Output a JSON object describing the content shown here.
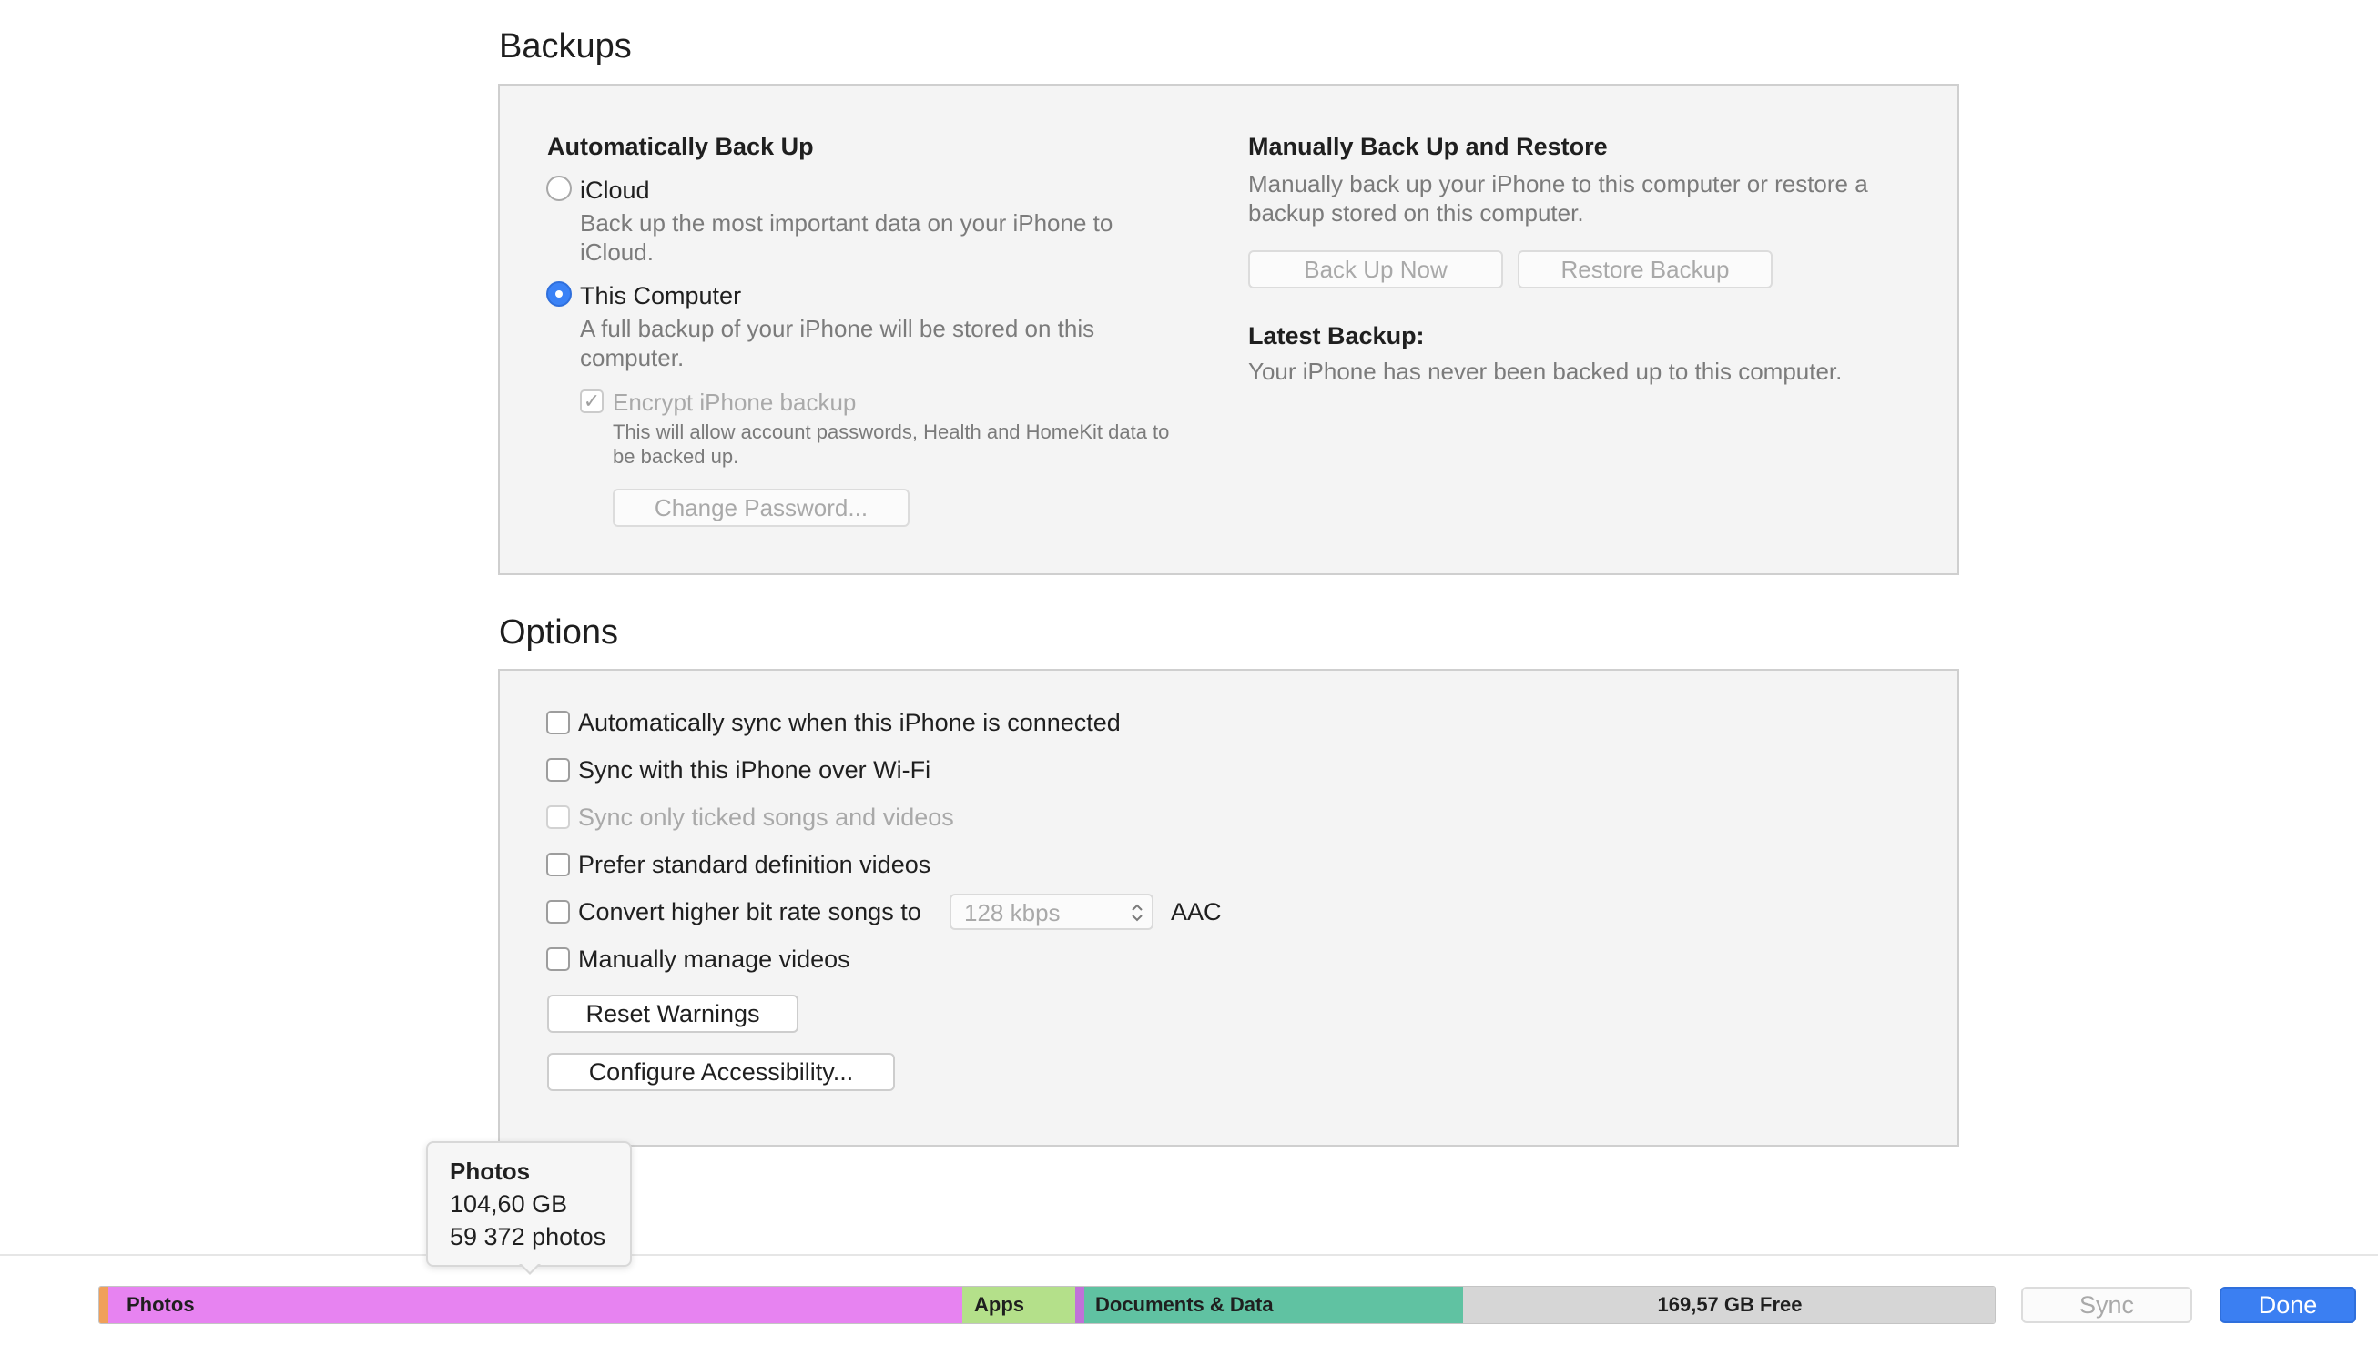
{
  "backups": {
    "title": "Backups",
    "auto": {
      "heading": "Automatically Back Up",
      "icloud_label": "iCloud",
      "icloud_desc_1": "Back up the most important data on your iPhone to",
      "icloud_desc_2": "iCloud.",
      "computer_label": "This Computer",
      "computer_desc_1": "A full backup of your iPhone will be stored on this",
      "computer_desc_2": "computer.",
      "encrypt_label": "Encrypt iPhone backup",
      "encrypt_desc_1": "This will allow account passwords, Health and HomeKit data to",
      "encrypt_desc_2": "be backed up.",
      "change_password": "Change Password...",
      "selected": "This Computer"
    },
    "manual": {
      "heading": "Manually Back Up and Restore",
      "desc_1": "Manually back up your iPhone to this computer or restore a",
      "desc_2": "backup stored on this computer.",
      "back_up_now": "Back Up Now",
      "restore_backup": "Restore Backup",
      "latest_heading": "Latest Backup:",
      "latest_text": "Your iPhone has never been backed up to this computer."
    }
  },
  "options": {
    "title": "Options",
    "items": [
      {
        "label": "Automatically sync when this iPhone is connected",
        "checked": false,
        "enabled": true
      },
      {
        "label": "Sync with this iPhone over Wi-Fi",
        "checked": false,
        "enabled": true
      },
      {
        "label": "Sync only ticked songs and videos",
        "checked": false,
        "enabled": false
      },
      {
        "label": "Prefer standard definition videos",
        "checked": false,
        "enabled": true
      },
      {
        "label": "Convert higher bit rate songs to",
        "checked": false,
        "enabled": true
      },
      {
        "label": "Manually manage videos",
        "checked": false,
        "enabled": true
      }
    ],
    "bitrate_value": "128 kbps",
    "bitrate_format": "AAC",
    "reset_warnings": "Reset Warnings",
    "configure_accessibility": "Configure Accessibility..."
  },
  "tooltip": {
    "title": "Photos",
    "size": "104,60 GB",
    "count": "59 372 photos"
  },
  "storage_bar": {
    "segments": [
      {
        "label": "Photos",
        "color": "#e783f1"
      },
      {
        "label": "Apps",
        "color": "#b4e08a"
      },
      {
        "label": "Documents & Data",
        "color": "#60c2a2"
      },
      {
        "label": "169,57 GB Free",
        "color": "#d6d6d6"
      }
    ]
  },
  "footer": {
    "sync": "Sync",
    "done": "Done"
  }
}
